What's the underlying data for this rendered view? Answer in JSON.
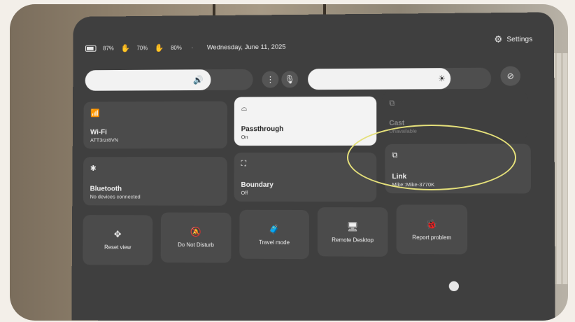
{
  "status": {
    "battery": "87%",
    "controller_left": "70%",
    "controller_right": "80%",
    "separator": "·",
    "date": "Wednesday, June 11, 2025"
  },
  "settings": {
    "label": "Settings"
  },
  "volume": {
    "level_percent": 75,
    "icon": "speaker-icon"
  },
  "brightness": {
    "level_percent": 90,
    "icon": "sun-icon"
  },
  "tiles": {
    "wifi": {
      "title": "Wi-Fi",
      "sub": "ATT3rzr8VN"
    },
    "passthrough": {
      "title": "Passthrough",
      "sub": "On"
    },
    "cast": {
      "title": "Cast",
      "sub": "Unavailable"
    },
    "bluetooth": {
      "title": "Bluetooth",
      "sub": "No devices connected"
    },
    "boundary": {
      "title": "Boundary",
      "sub": "Off"
    },
    "link": {
      "title": "Link",
      "sub": "Mike::Mike-3770K"
    }
  },
  "small_tiles": {
    "reset_view": "Reset view",
    "dnd": "Do Not Disturb",
    "travel": "Travel mode",
    "remote": "Remote Desktop",
    "report": "Report problem"
  }
}
